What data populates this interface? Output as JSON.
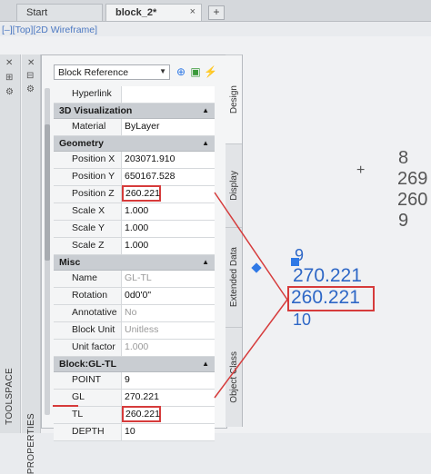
{
  "tabs": {
    "start": "Start",
    "active": "block_2*",
    "close_glyph": "×",
    "new_tab_glyph": "+"
  },
  "viewport_label": "[–][Top][2D Wireframe]",
  "left_strip": {
    "toolspace_label": "TOOLSPACE"
  },
  "palette": {
    "properties_label": "PROPERTIES"
  },
  "properties": {
    "object_type": "Block Reference",
    "rows_top": [
      {
        "label": "Hyperlink",
        "value": ""
      }
    ],
    "categories": {
      "visualization": "3D Visualization",
      "geometry": "Geometry",
      "misc": "Misc",
      "block": "Block:GL-TL"
    },
    "visualization_rows": [
      {
        "label": "Material",
        "value": "ByLayer"
      }
    ],
    "geometry_rows": [
      {
        "label": "Position X",
        "value": "203071.910"
      },
      {
        "label": "Position Y",
        "value": "650167.528"
      },
      {
        "label": "Position Z",
        "value": "260.221"
      },
      {
        "label": "Scale X",
        "value": "1.000"
      },
      {
        "label": "Scale Y",
        "value": "1.000"
      },
      {
        "label": "Scale Z",
        "value": "1.000"
      }
    ],
    "misc_rows": [
      {
        "label": "Name",
        "value": "GL-TL"
      },
      {
        "label": "Rotation",
        "value": "0d0'0\""
      },
      {
        "label": "Annotative",
        "value": "No"
      },
      {
        "label": "Block Unit",
        "value": "Unitless"
      },
      {
        "label": "Unit factor",
        "value": "1.000"
      }
    ],
    "block_rows": [
      {
        "label": "POINT",
        "value": "9"
      },
      {
        "label": "GL",
        "value": "270.221"
      },
      {
        "label": "TL",
        "value": "260.221"
      },
      {
        "label": "DEPTH",
        "value": "10"
      }
    ]
  },
  "side_tabs": [
    "Design",
    "Display",
    "Extended Data",
    "Object Class"
  ],
  "drawing": {
    "right_block": [
      "8",
      "269",
      "260",
      "9"
    ],
    "center_block": [
      "9",
      "270.221",
      "260.221",
      "10"
    ]
  },
  "colors": {
    "highlight": "#d63b3b",
    "annotation_text": "#2e67c6",
    "grip": "#2f79e6"
  }
}
